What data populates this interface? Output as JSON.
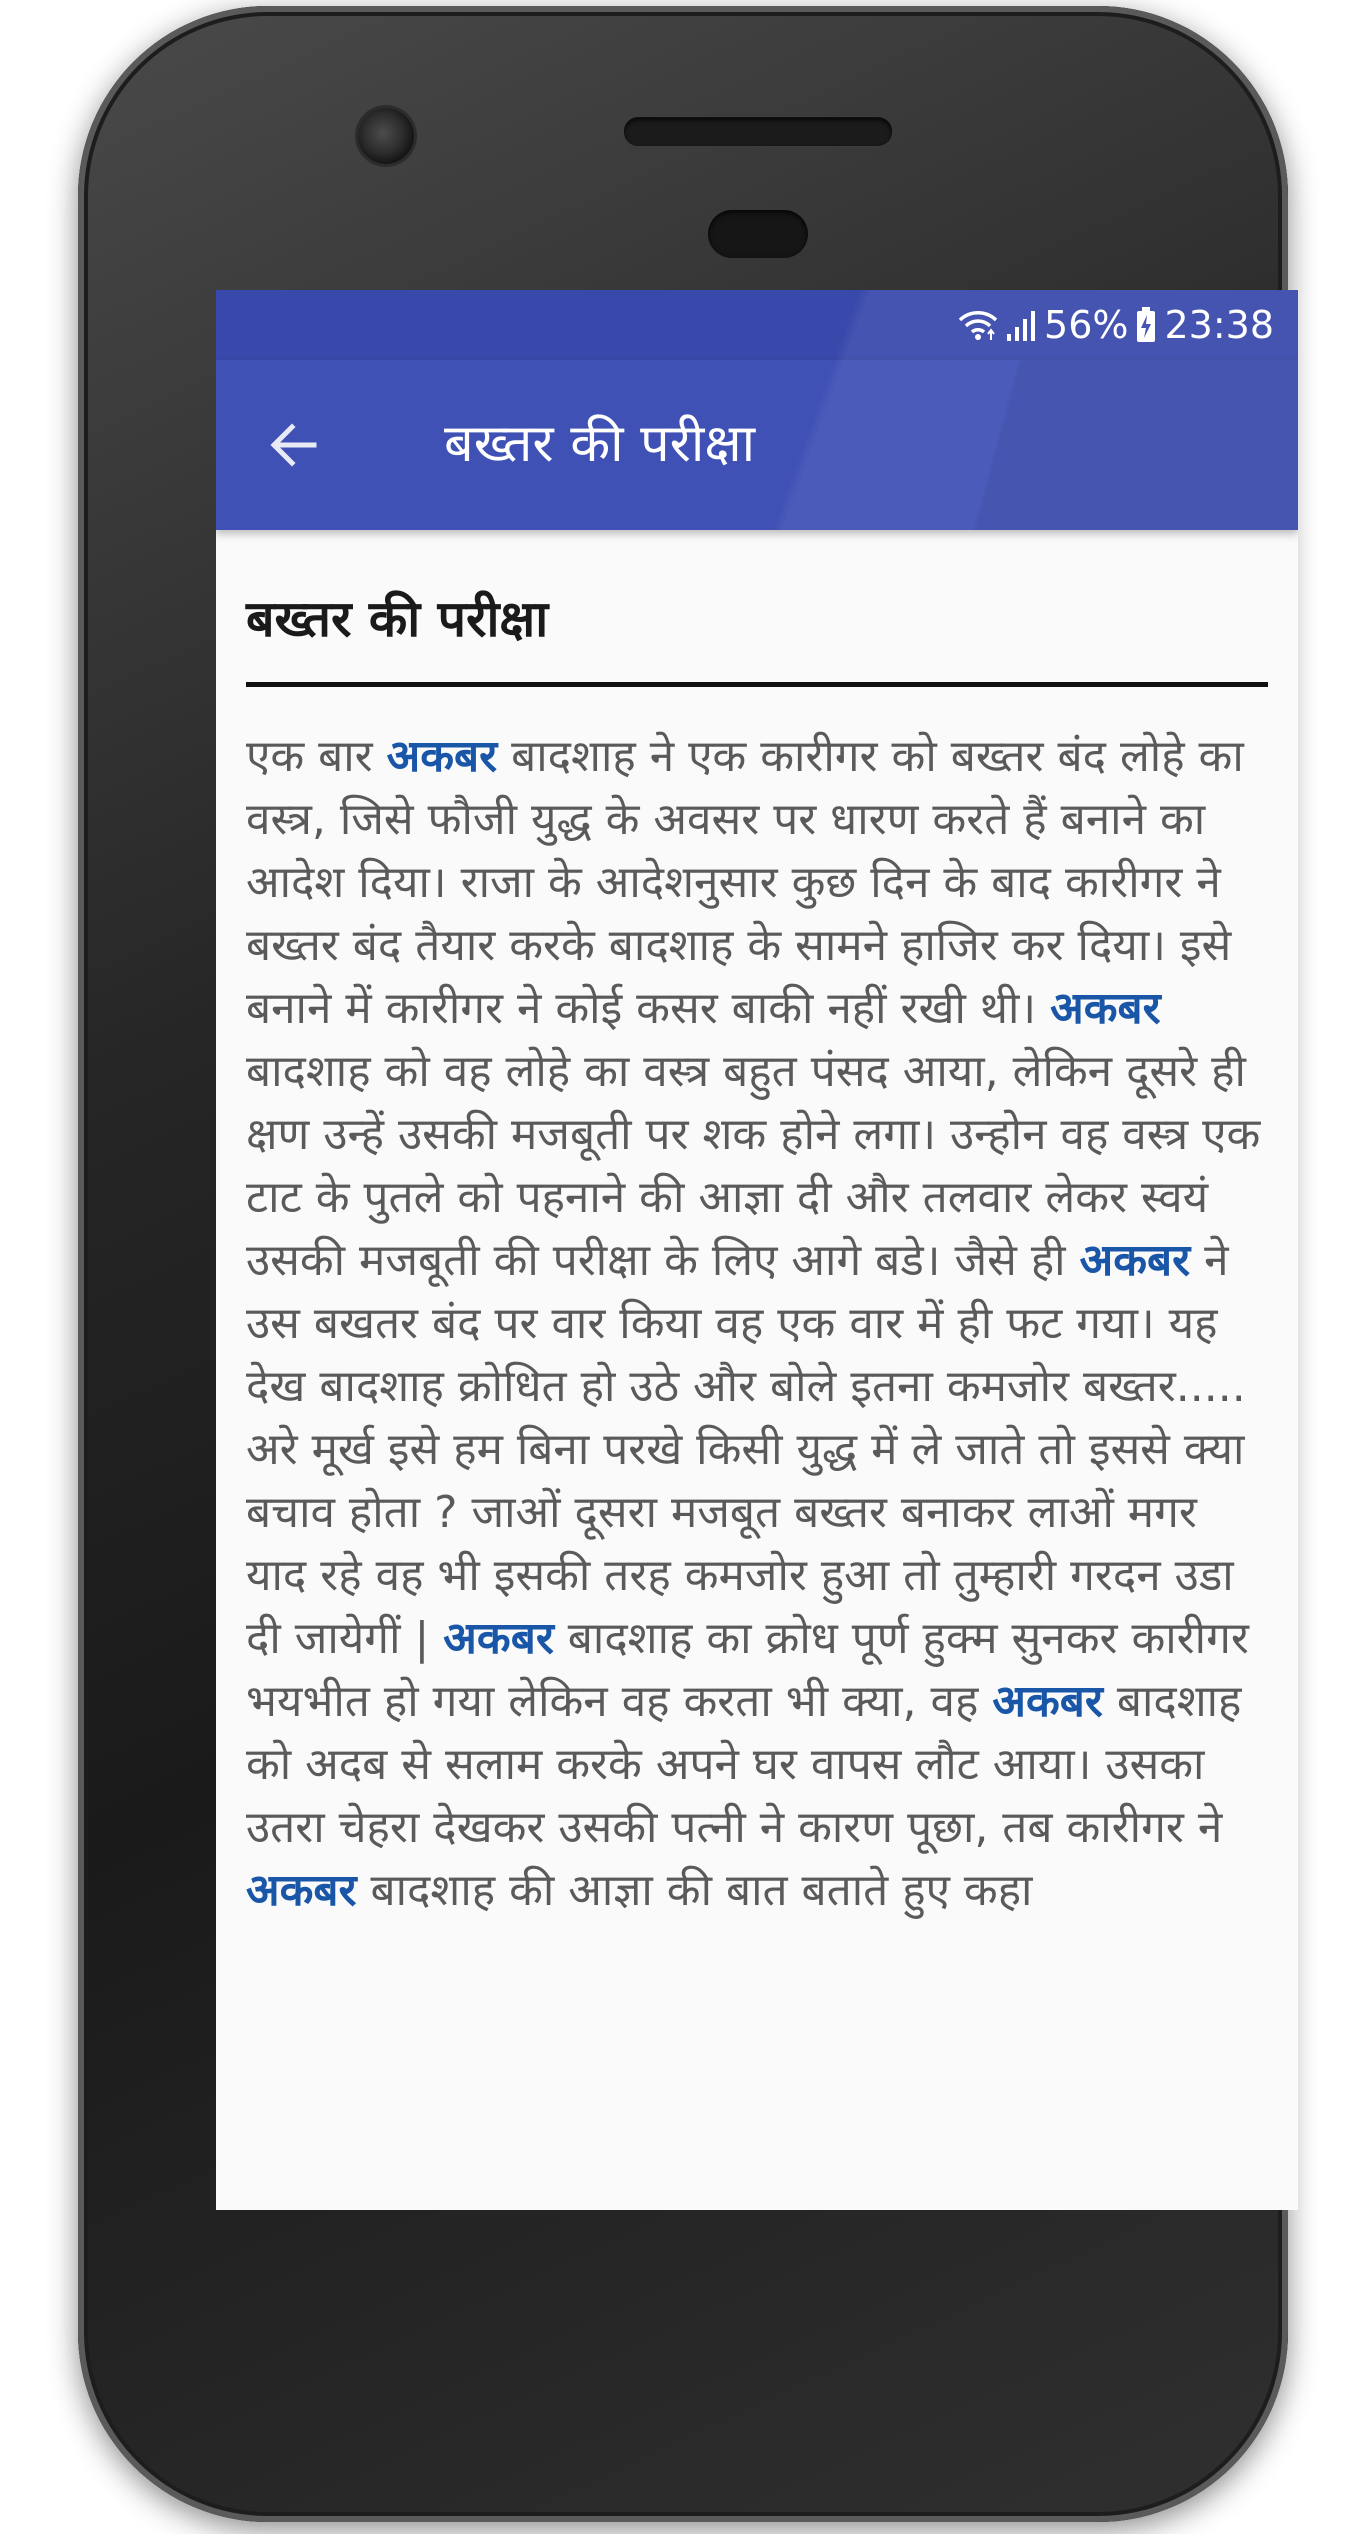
{
  "status_bar": {
    "battery": "56%",
    "time": "23:38",
    "icons": [
      "wifi-icon",
      "signal-icon",
      "battery-icon"
    ]
  },
  "app_bar": {
    "title": "बख्तर की परीक्षा",
    "back_icon": "arrow-left-icon"
  },
  "story": {
    "heading": "बख्तर की परीक्षा",
    "paragraph": [
      {
        "text": "एक बार ",
        "highlight": false
      },
      {
        "text": "अकबर",
        "highlight": true
      },
      {
        "text": " बादशाह ने एक कारीगर को बख्तर बंद लोहे का वस्त्र, जिसे फौजी युद्ध के अवसर पर धारण करते हैं बनाने का आदेश दिया। राजा के आदेशनुसार कुछ दिन के बाद कारीगर ने बख्तर बंद तैयार करके बादशाह के सामने हाजिर कर दिया। इसे बनाने में कारीगर ने कोई कसर बाकी नहीं रखी थी। ",
        "highlight": false
      },
      {
        "text": "अकबर",
        "highlight": true
      },
      {
        "text": " बादशाह को वह लोहे का वस्त्र बहुत पंसद आया, लेकिन दूसरे ही क्षण उन्हें उसकी मजबूती पर शक होने लगा। उन्होेन वह वस्त्र एक टाट के पुतले को पहनाने की आज्ञा दी और तलवार लेकर स्वयं उसकी मजबूती की परीक्षा के लिए आगे बडे। जैसे ही ",
        "highlight": false
      },
      {
        "text": "अकबर",
        "highlight": true
      },
      {
        "text": " ने उस बखतर बंद पर वार किया वह एक वार में ही फट गया। यह देख बादशाह क्रोधित हो उठे और बोले इतना कमजोर बख्तर..... अरे मूर्ख इसे हम बिना परखे किसी युद्ध में ले जाते तो इससे क्या बचाव होता ? जाओं दूसरा मजबूत बख्तर बनाकर लाओं मगर याद रहे वह भी इसकी तरह कमजोर हुआ तो तुम्हारी गरदन उडा दी जायेगीं | ",
        "highlight": false
      },
      {
        "text": "अकबर",
        "highlight": true
      },
      {
        "text": " बादशाह का क्रोध पूर्ण हुक्म सुनकर कारीगर भयभीत हो गया लेकिन वह करता भी क्या, वह ",
        "highlight": false
      },
      {
        "text": "अकबर",
        "highlight": true
      },
      {
        "text": " बादशाह को अदब से सलाम करके अपने घर वापस लौट आया। उसका उतरा चेहरा देखकर उसकी पत्नी ने कारण पूछा, तब कारीगर ने ",
        "highlight": false
      },
      {
        "text": "अकबर",
        "highlight": true
      },
      {
        "text": " बादशाह की आज्ञा की बात बताते हुए कहा",
        "highlight": false
      }
    ]
  },
  "colors": {
    "status_bar": "#3949ab",
    "app_bar": "#3f51b5",
    "highlight": "#1a56a8",
    "body_text": "#5a5a5a"
  }
}
